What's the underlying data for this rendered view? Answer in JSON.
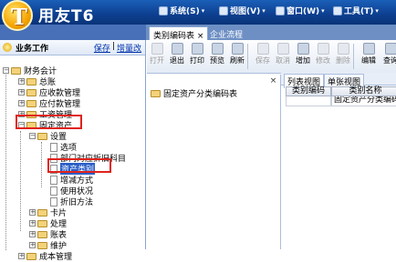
{
  "app": {
    "brand": "用友T6",
    "logo_letter": "T"
  },
  "menu": [
    {
      "label": "系统(S)"
    },
    {
      "label": "视图(V)"
    },
    {
      "label": "窗口(W)"
    },
    {
      "label": "工具(T)"
    }
  ],
  "tabs": [
    {
      "label": "类别编码表",
      "close": "×"
    },
    {
      "label": "企业流程"
    }
  ],
  "workpanel": {
    "title": "业务工作",
    "links": [
      "保存",
      "增量改"
    ]
  },
  "tree": {
    "root": "财务会计",
    "items": [
      "总账",
      "应收款管理",
      "应付款管理",
      "工资管理",
      "固定资产"
    ],
    "setup": "设置",
    "setup_children": [
      "选项",
      "部门对应折旧科目",
      "资产类别",
      "增减方式",
      "使用状况",
      "折旧方法"
    ],
    "others": [
      "卡片",
      "处理",
      "账表",
      "维护"
    ],
    "cost": "成本管理"
  },
  "toolbar": [
    {
      "label": "打开",
      "enabled": false
    },
    {
      "label": "退出",
      "enabled": true
    },
    {
      "label": "打印",
      "enabled": true
    },
    {
      "label": "预览",
      "enabled": true
    },
    {
      "label": "刷新",
      "enabled": true
    },
    {
      "label": "保存",
      "enabled": false
    },
    {
      "label": "取消",
      "enabled": false
    },
    {
      "label": "增加",
      "enabled": true
    },
    {
      "label": "修改",
      "enabled": false
    },
    {
      "label": "删除",
      "enabled": false
    },
    {
      "label": "编辑",
      "enabled": true
    },
    {
      "label": "查询",
      "enabled": true
    }
  ],
  "category_tree": {
    "root": "固定资产分类编码表",
    "close": "×"
  },
  "view_tabs": [
    "列表视图",
    "单张视图"
  ],
  "grid": {
    "headers": [
      "类别编码",
      "类别名称"
    ],
    "rows": [
      [
        "",
        "固定资产分类编码表"
      ]
    ]
  }
}
